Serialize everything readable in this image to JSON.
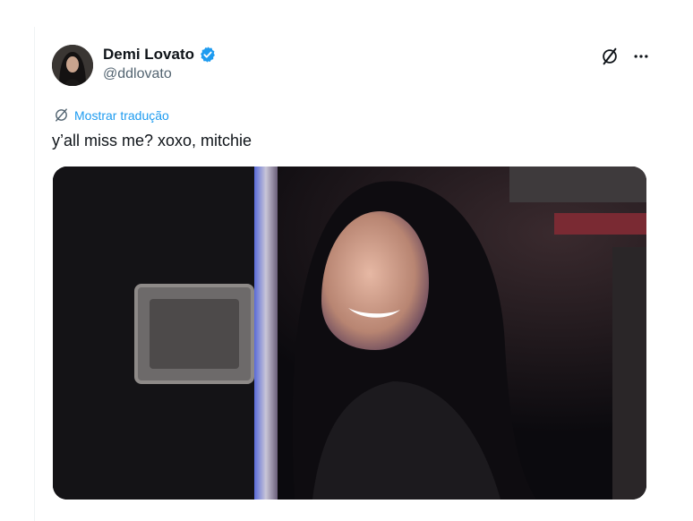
{
  "author": {
    "display_name": "Demi Lovato",
    "handle": "@ddlovato",
    "verified": true
  },
  "translate": {
    "label": "Mostrar tradução"
  },
  "tweet": {
    "text": "y’all miss me? xoxo, mitchie"
  },
  "icons": {
    "grok": "grok-icon",
    "more": "more-icon",
    "translate": "globe-icon",
    "verified": "verified-badge-icon"
  },
  "colors": {
    "accent": "#1d9bf0",
    "text_primary": "#0f1419",
    "text_secondary": "#536471"
  }
}
